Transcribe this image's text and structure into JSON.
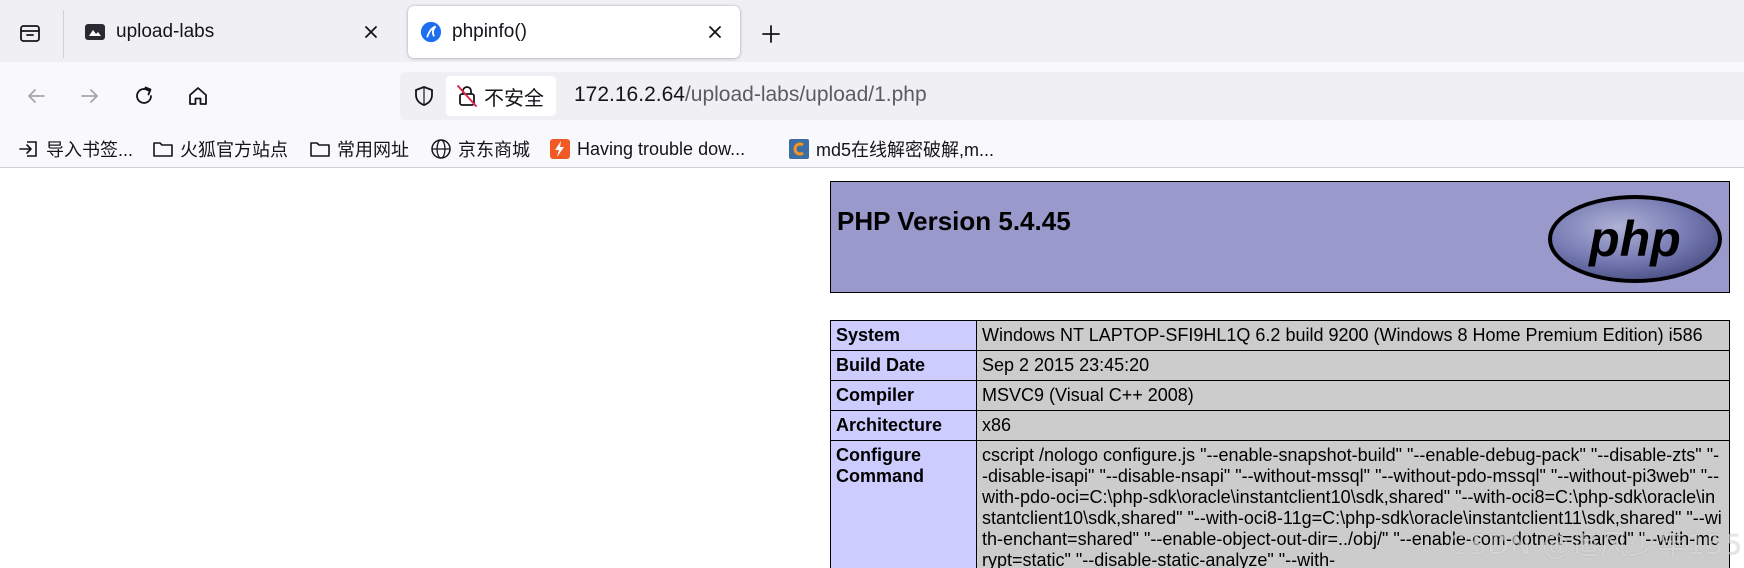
{
  "tabs": [
    {
      "title": "upload-labs",
      "favicon": "upload-labs-favicon-icon",
      "active": false
    },
    {
      "title": "phpinfo()",
      "favicon": "firefox-nightly-icon",
      "active": true
    }
  ],
  "nav": {
    "security_label": "不安全",
    "url_host": "172.16.2.64",
    "url_path": "/upload-labs/upload/1.php"
  },
  "bookmarks": [
    {
      "label": "导入书签...",
      "icon": "import-icon"
    },
    {
      "label": "火狐官方站点",
      "icon": "folder-icon"
    },
    {
      "label": "常用网址",
      "icon": "folder-icon"
    },
    {
      "label": "京东商城",
      "icon": "globe-icon"
    },
    {
      "label": "Having trouble dow...",
      "icon": "bolt-favicon-icon"
    },
    {
      "label": "md5在线解密破解,m...",
      "icon": "cmd5-favicon-icon"
    }
  ],
  "phpinfo": {
    "version_title": "PHP Version 5.4.45",
    "logo_text": "php",
    "rows": [
      {
        "key": "System",
        "value": "Windows NT LAPTOP-SFI9HL1Q 6.2 build 9200 (Windows 8 Home Premium Edition) i586"
      },
      {
        "key": "Build Date",
        "value": "Sep 2 2015 23:45:20"
      },
      {
        "key": "Compiler",
        "value": "MSVC9 (Visual C++ 2008)"
      },
      {
        "key": "Architecture",
        "value": "x86"
      },
      {
        "key": "Configure Command",
        "value": "cscript /nologo configure.js \"--enable-snapshot-build\" \"--enable-debug-pack\" \"--disable-zts\" \"--disable-isapi\" \"--disable-nsapi\" \"--without-mssql\" \"--without-pdo-mssql\" \"--without-pi3web\" \"--with-pdo-oci=C:\\php-sdk\\oracle\\instantclient10\\sdk,shared\" \"--with-oci8=C:\\php-sdk\\oracle\\instantclient10\\sdk,shared\" \"--with-oci8-11g=C:\\php-sdk\\oracle\\instantclient11\\sdk,shared\" \"--with-enchant=shared\" \"--enable-object-out-dir=../obj/\" \"--enable-com-dotnet=shared\" \"--with-mcrypt=static\" \"--disable-static-analyze\" \"--with-"
      }
    ]
  },
  "watermark": "CSDN @追风少年155",
  "colors": {
    "php_header_bg": "#9999cc",
    "php_key_bg": "#ccccff",
    "php_value_bg": "#cccccc",
    "tabstrip_bg": "#f0f0f4"
  }
}
